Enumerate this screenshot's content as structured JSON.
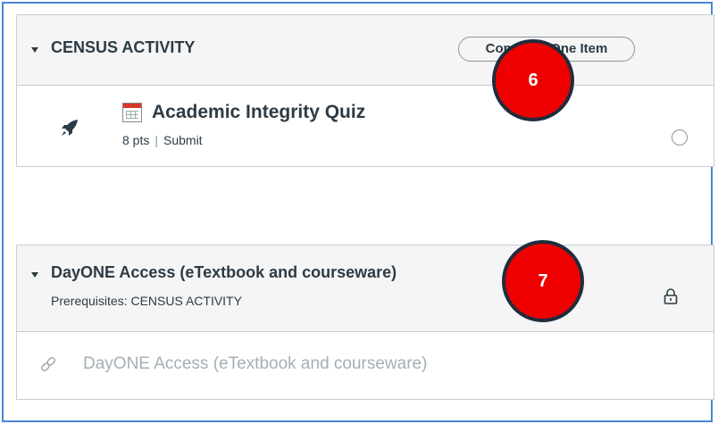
{
  "modules": [
    {
      "title": "CENSUS ACTIVITY",
      "requirement": "Complete One Item",
      "items": [
        {
          "icon": "quiz-icon",
          "title": "Academic Integrity Quiz",
          "points": "8 pts",
          "separator": "|",
          "requirement": "Submit"
        }
      ]
    },
    {
      "title": "DayONE Access (eTextbook and courseware)",
      "prerequisites": "Prerequisites: CENSUS ACTIVITY",
      "locked": true,
      "items": [
        {
          "icon": "link-icon",
          "title": "DayONE Access (eTextbook and courseware)"
        }
      ]
    }
  ],
  "annotations": [
    "6",
    "7"
  ],
  "colors": {
    "frame_border": "#4a86d4",
    "header_bg": "#f5f5f5",
    "text": "#2d3b45",
    "muted_text": "#a5afb5",
    "badge_red": "#ee0000",
    "badge_border": "#1f2d3d"
  }
}
